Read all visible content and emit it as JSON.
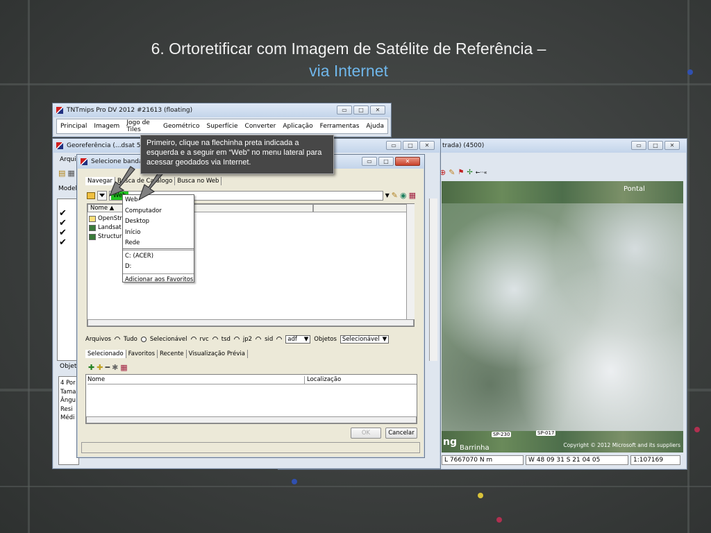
{
  "slide": {
    "title_line1": "6. Ortoretificar com Imagem de Satélite de Referência –",
    "title_line2": "via Internet"
  },
  "main_window": {
    "title": "TNTmips Pro DV 2012  #21613 (floating)",
    "menu": [
      "Principal",
      "Imagem",
      "Jogo de Tiles",
      "Geométrico",
      "Superfície",
      "Converter",
      "Aplicação",
      "Ferramentas",
      "Ajuda"
    ]
  },
  "georef_window": {
    "title": "Georeferência (...dsat 5 Az",
    "menu_first": "Arqui",
    "model_label": "Model",
    "objects_label": "Objet",
    "side_lines": [
      "4 Por",
      "Tama",
      "Ângu",
      "Resi",
      "Médi"
    ]
  },
  "view_window": {
    "title_suffix": "trada) (4500)",
    "map_labels": {
      "pontal": "Pontal",
      "sp230": "SP-230",
      "sp017": "SP-017",
      "barrinha": "Barrinha",
      "bing": "ng",
      "copyright": "Copyright © 2012 Microsoft and its suppliers"
    },
    "status": {
      "coord_n": "L 7667070 N m",
      "lonlat": "W 48 09 31  S 21 04 05",
      "scale": "1:107169"
    },
    "toolbar_text": "←··«"
  },
  "dialog": {
    "title": "Selecione banda",
    "tabs": [
      "Navegar",
      "Busca de Catálogo",
      "Busca no Web"
    ],
    "location_value": "Web",
    "file_header": "Nome ▲",
    "files": [
      "OpenStr",
      "Landsat",
      "Structura"
    ],
    "filter": {
      "label": "Arquivos",
      "options": [
        "Tudo",
        "Selecionável",
        "rvc",
        "tsd",
        "jp2",
        "sid"
      ],
      "extension": "adf",
      "objects_label": "Objetos",
      "objects_value": "Selecionável"
    },
    "bottom_tabs": [
      "Selecionado",
      "Favoritos",
      "Recente",
      "Visualização Prévia"
    ],
    "columns": {
      "name": "Nome",
      "location": "Localização"
    },
    "ok_label": "OK",
    "cancel_label": "Cancelar"
  },
  "context_menu": {
    "items": [
      "Web",
      "Computador",
      "Desktop",
      "Início",
      "Rede"
    ],
    "drives": [
      "C: (ACER)",
      "D:"
    ],
    "favorites": "Adicionar aos Favoritos"
  },
  "callout": {
    "text": "Primeiro, clique na flechinha preta indicada a esquerda e a seguir em “Web” no menu lateral para acessar geodados via Internet."
  },
  "window_buttons": {
    "minimize": "▭",
    "maximize": "□",
    "close": "✕"
  },
  "colors": {
    "title_blue": "#6fb6ea",
    "callout_bg": "#474747",
    "web_green": "#22c222"
  }
}
